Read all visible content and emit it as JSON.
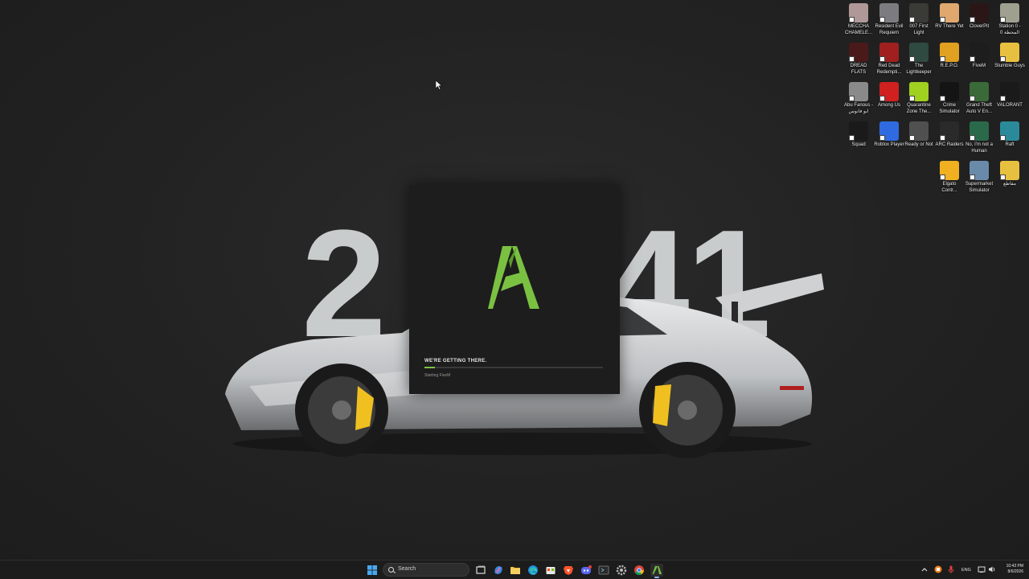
{
  "wallpaper": {
    "numbers": [
      "2",
      "41"
    ],
    "accent": "#f0c020"
  },
  "desktop_icons": [
    {
      "name": "MECCHA CHAMELE...",
      "color": "#b09898"
    },
    {
      "name": "Resident Evil Requiem",
      "color": "#7c7c80"
    },
    {
      "name": "007 First Light",
      "color": "#3a3a36"
    },
    {
      "name": "RV There Yet",
      "color": "#e0a86e"
    },
    {
      "name": "CloverPit",
      "color": "#2a1616"
    },
    {
      "name": "Station 0 - المحطة 0",
      "color": "#a0a090"
    },
    {
      "name": "DREAD FLATS",
      "color": "#4a1a1a"
    },
    {
      "name": "Red Dead Redempti...",
      "color": "#a02020"
    },
    {
      "name": "The Lightkeeper",
      "color": "#2f4a40"
    },
    {
      "name": "R.E.P.O.",
      "color": "#e0a020"
    },
    {
      "name": "FiveM",
      "color": "#1d1d1d"
    },
    {
      "name": "Stumble Guys",
      "color": "#e8c040"
    },
    {
      "name": "Abu Fanous - ابو فانوس",
      "color": "#8a8a8a"
    },
    {
      "name": "Among Us",
      "color": "#d02020"
    },
    {
      "name": "Quarantine Zone The...",
      "color": "#a0d020"
    },
    {
      "name": "Crime Simulator",
      "color": "#141414"
    },
    {
      "name": "Grand Theft Auto V En...",
      "color": "#3a6a38"
    },
    {
      "name": "VALORANT",
      "color": "#1a1a1a"
    },
    {
      "name": "Squad",
      "color": "#1a1a1a"
    },
    {
      "name": "Roblox Player",
      "color": "#2f6ae0"
    },
    {
      "name": "Ready or Not",
      "color": "#505050"
    },
    {
      "name": "ARC Raiders",
      "color": "#2a2a2a"
    },
    {
      "name": "No, I'm not a Human",
      "color": "#2a6a4a"
    },
    {
      "name": "Raft",
      "color": "#2a8a9a"
    },
    {
      "name": "Elgato Contr...",
      "color": "#f0b020"
    },
    {
      "name": "Supermarket Simulator",
      "color": "#6a8aaa"
    },
    {
      "name": "مقاطع",
      "color": "#e8c040"
    }
  ],
  "launcher": {
    "status": "WE'RE GETTING THERE.",
    "progress": 0.06,
    "substatus": "Starting FiveM",
    "accent": "#7ac142"
  },
  "taskbar": {
    "search_placeholder": "Search",
    "apps": [
      "start-icon",
      "task-view-icon",
      "copilot-icon",
      "file-explorer-icon",
      "edge-icon",
      "store-icon",
      "brave-icon",
      "discord-icon",
      "terminal-icon",
      "settings-icon",
      "chrome-icon",
      "fivem-icon"
    ],
    "tray": {
      "language": "ENG",
      "time": "10:43 PM",
      "date": "8/6/2026"
    }
  }
}
